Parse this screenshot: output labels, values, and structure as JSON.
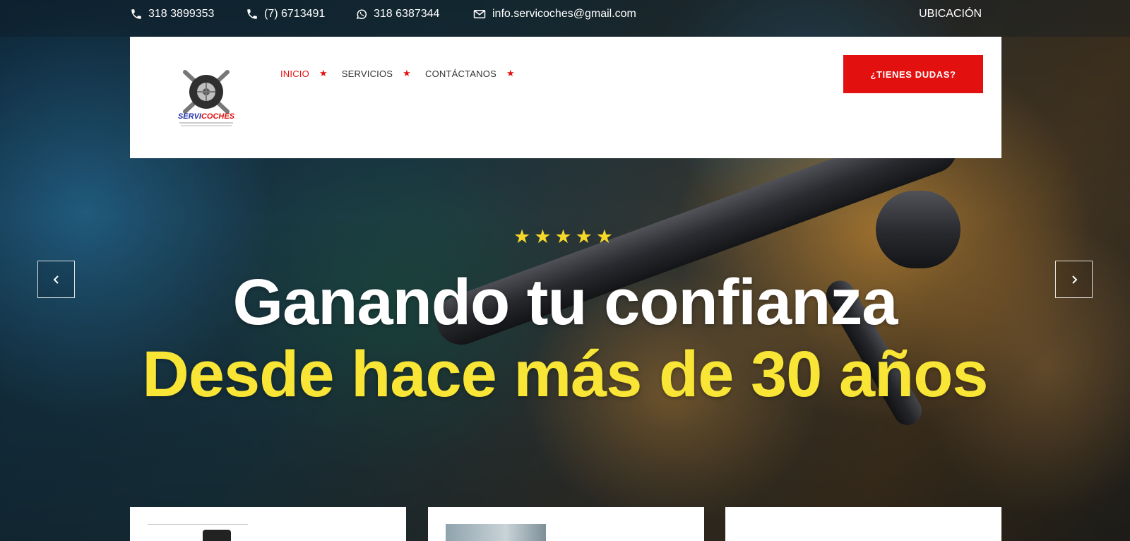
{
  "topbar": {
    "contacts": [
      {
        "icon": "phone-icon",
        "text": "318 3899353"
      },
      {
        "icon": "phone-icon",
        "text": "(7) 6713491"
      },
      {
        "icon": "whatsapp-icon",
        "text": "318 6387344"
      },
      {
        "icon": "envelope-icon",
        "text": "info.servicoches@gmail.com"
      }
    ],
    "location_label": "UBICACIÓN"
  },
  "header": {
    "logo_alt": "SERVICOCHES",
    "nav": [
      {
        "label": "INICIO",
        "active": true
      },
      {
        "label": "SERVICIOS",
        "active": false
      },
      {
        "label": "CONTÁCTANOS",
        "active": false
      }
    ],
    "cta_label": "¿TIENES DUDAS?"
  },
  "hero": {
    "stars": "★★★★★",
    "rating": 5,
    "title": "Ganando tu confianza",
    "subtitle": "Desde hace más de 30 años"
  },
  "colors": {
    "accent_red": "#e31010",
    "highlight_yellow": "#f8e535",
    "star_yellow": "#f6d928"
  }
}
